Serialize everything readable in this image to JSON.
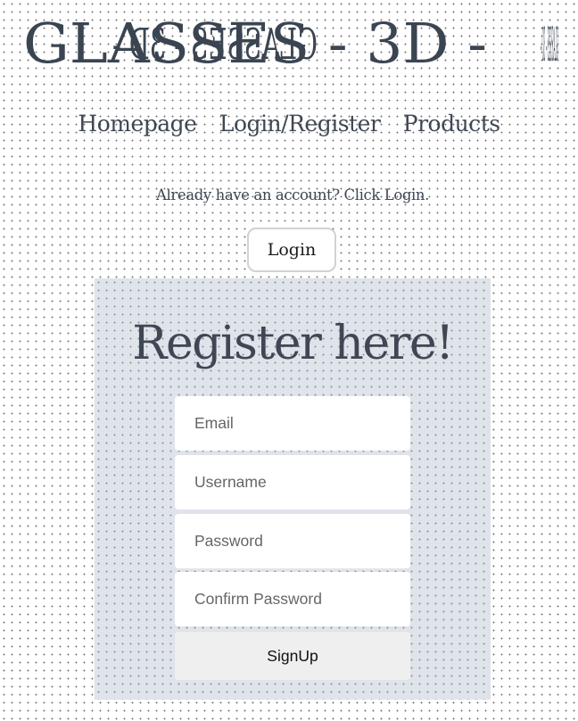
{
  "header": {
    "logo_text": "GLASSES - 3D -"
  },
  "nav": {
    "items": [
      {
        "label": "Homepage"
      },
      {
        "label": "Login/Register"
      },
      {
        "label": "Products"
      }
    ]
  },
  "login_prompt": {
    "text": "Already have an account? Click Login.",
    "button_label": "Login"
  },
  "register": {
    "title": "Register here!",
    "fields": {
      "email": {
        "placeholder": "Email",
        "value": ""
      },
      "username": {
        "placeholder": "Username",
        "value": ""
      },
      "password": {
        "placeholder": "Password",
        "value": ""
      },
      "confirm_password": {
        "placeholder": "Confirm Password",
        "value": ""
      }
    },
    "submit_label": "SignUp"
  },
  "colors": {
    "text": "#3f4754",
    "panel_bg": "#dfe3ea",
    "button_bg": "#efefef"
  }
}
